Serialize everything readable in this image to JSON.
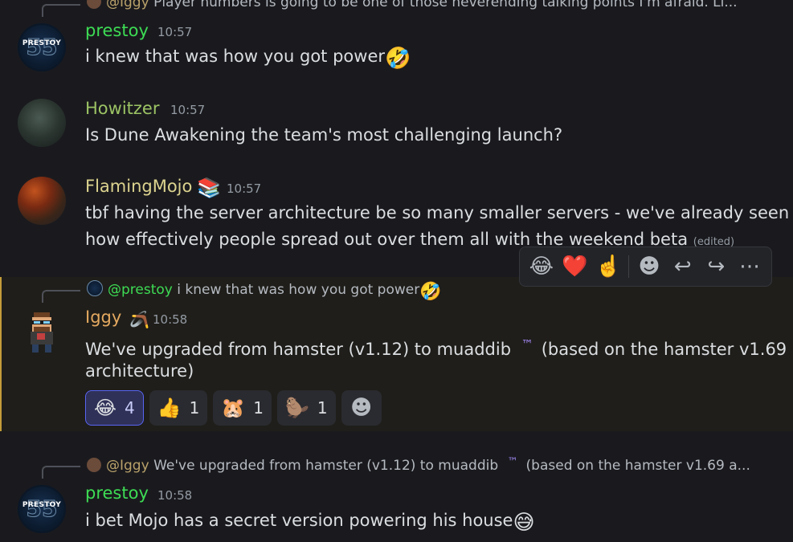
{
  "top_reply": {
    "author": "@Iggy",
    "text": "Player numbers is going to be one of those neverending talking points I'm afraid. Li..."
  },
  "messages": [
    {
      "author": "prestoy",
      "author_color": "#3ddc54",
      "time": "10:57",
      "text": "i knew that was how you got power",
      "emoji": "🤣"
    },
    {
      "author": "Howitzer",
      "author_color": "#9cc364",
      "time": "10:57",
      "text": "Is Dune Awakening the team's most challenging launch?"
    },
    {
      "author": "FlamingMojo",
      "author_color": "#dcd38f",
      "badge": "📚",
      "time": "10:57",
      "lines": [
        "tbf having the server architecture be so many smaller servers - we've already seen",
        "how effectively people spread out over them all with the weekend beta"
      ],
      "edited": "(edited)"
    },
    {
      "reply_to": {
        "author": "@prestoy",
        "text": "i knew that was how you got power",
        "emoji": "🤣"
      },
      "author": "Iggy",
      "author_color": "#e4a960",
      "badge": "🪃",
      "time": "10:58",
      "lines": [
        "We've upgraded from hamster (v1.12) to muaddib",
        "architecture)"
      ],
      "tm": "™",
      "line1_tail": "(based on the hamster v1.69",
      "reactions": [
        {
          "emoji": "😂",
          "count": "4",
          "active": true
        },
        {
          "emoji": "👍",
          "count": "1",
          "active": false
        },
        {
          "emoji": "🐹",
          "count": "1",
          "active": false
        },
        {
          "emoji": "🦫",
          "count": "1",
          "active": false
        }
      ],
      "add_reaction": "☻"
    },
    {
      "reply_to": {
        "author": "@Iggy",
        "text": "We've upgraded from hamster (v1.12) to muaddib",
        "tm": "™",
        "tail": "(based on the hamster v1.69 a..."
      },
      "author": "prestoy",
      "author_color": "#3ddc54",
      "time": "10:58",
      "text": "i bet Mojo has a secret version powering his house",
      "emoji": "😅"
    }
  ],
  "avatar_text": {
    "prestoy_label": "PRESTOY",
    "prestoy_num": "55"
  },
  "toolbar": {
    "react_1": "😂",
    "react_2": "❤️",
    "react_3": "☝️",
    "add_reaction": "☻",
    "reply": "↩",
    "forward": "↪",
    "more": "⋯"
  }
}
